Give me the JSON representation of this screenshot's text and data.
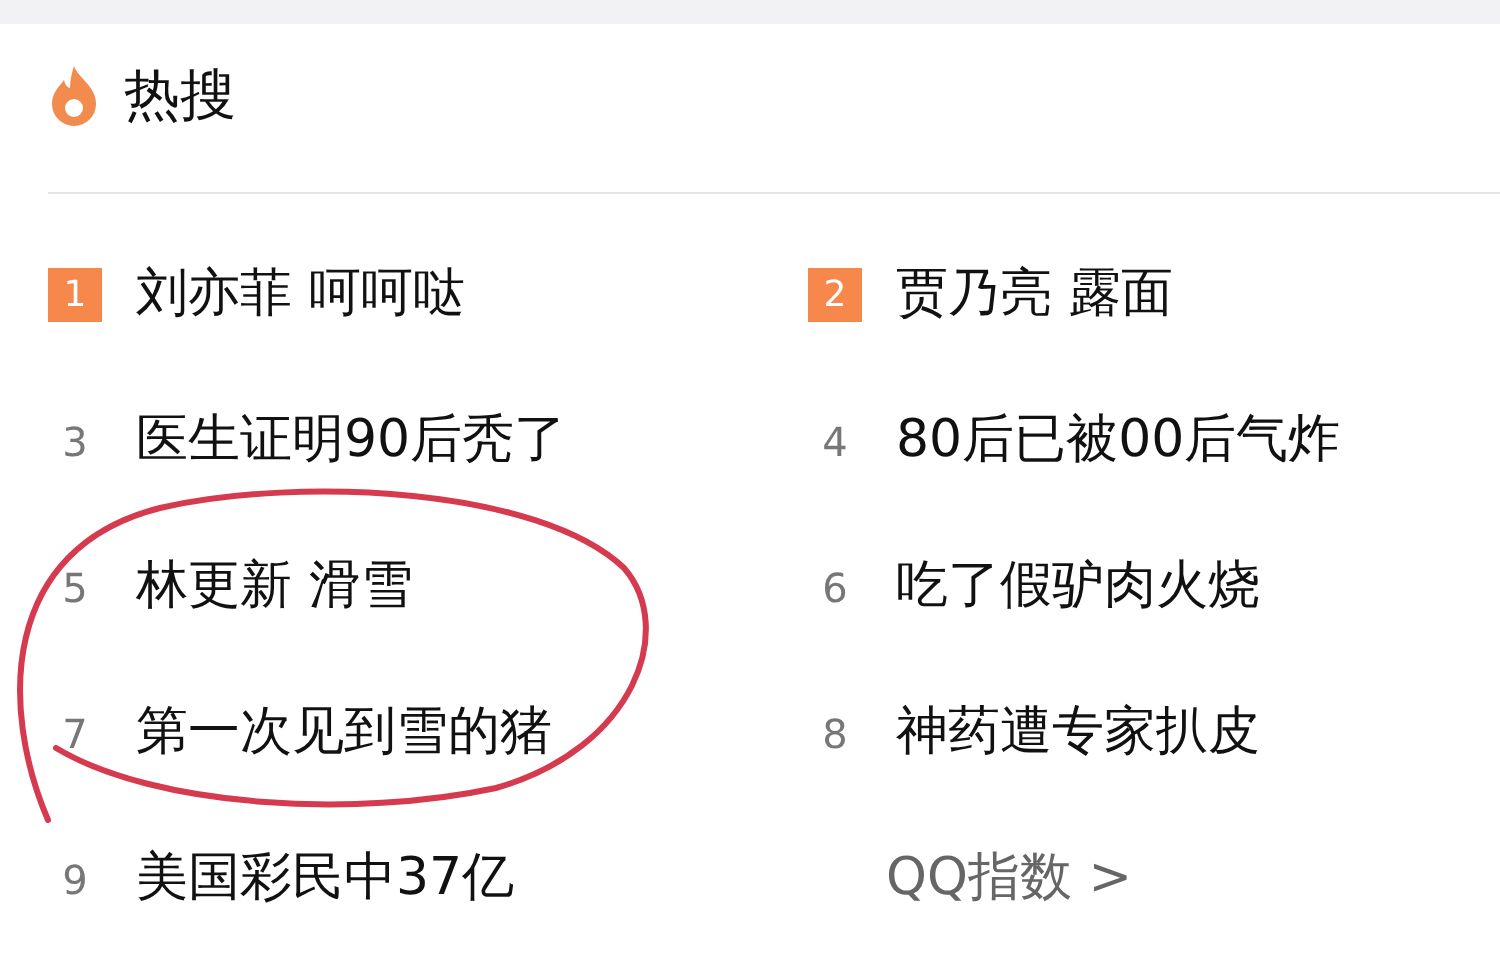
{
  "header": {
    "title": "热搜"
  },
  "items": [
    {
      "kind": "top",
      "rank": "1",
      "text": "刘亦菲 呵呵哒"
    },
    {
      "kind": "top",
      "rank": "2",
      "text": "贾乃亮 露面"
    },
    {
      "kind": "plain",
      "rank": "3",
      "text": "医生证明90后秃了"
    },
    {
      "kind": "plain",
      "rank": "4",
      "text": "80后已被00后气炸"
    },
    {
      "kind": "plain",
      "rank": "5",
      "text": "林更新 滑雪"
    },
    {
      "kind": "plain",
      "rank": "6",
      "text": "吃了假驴肉火烧"
    },
    {
      "kind": "plain",
      "rank": "7",
      "text": "第一次见到雪的猪"
    },
    {
      "kind": "plain",
      "rank": "8",
      "text": "神药遭专家扒皮"
    },
    {
      "kind": "plain",
      "rank": "9",
      "text": "美国彩民中37亿"
    },
    {
      "kind": "link",
      "text": "QQ指数 >"
    }
  ]
}
